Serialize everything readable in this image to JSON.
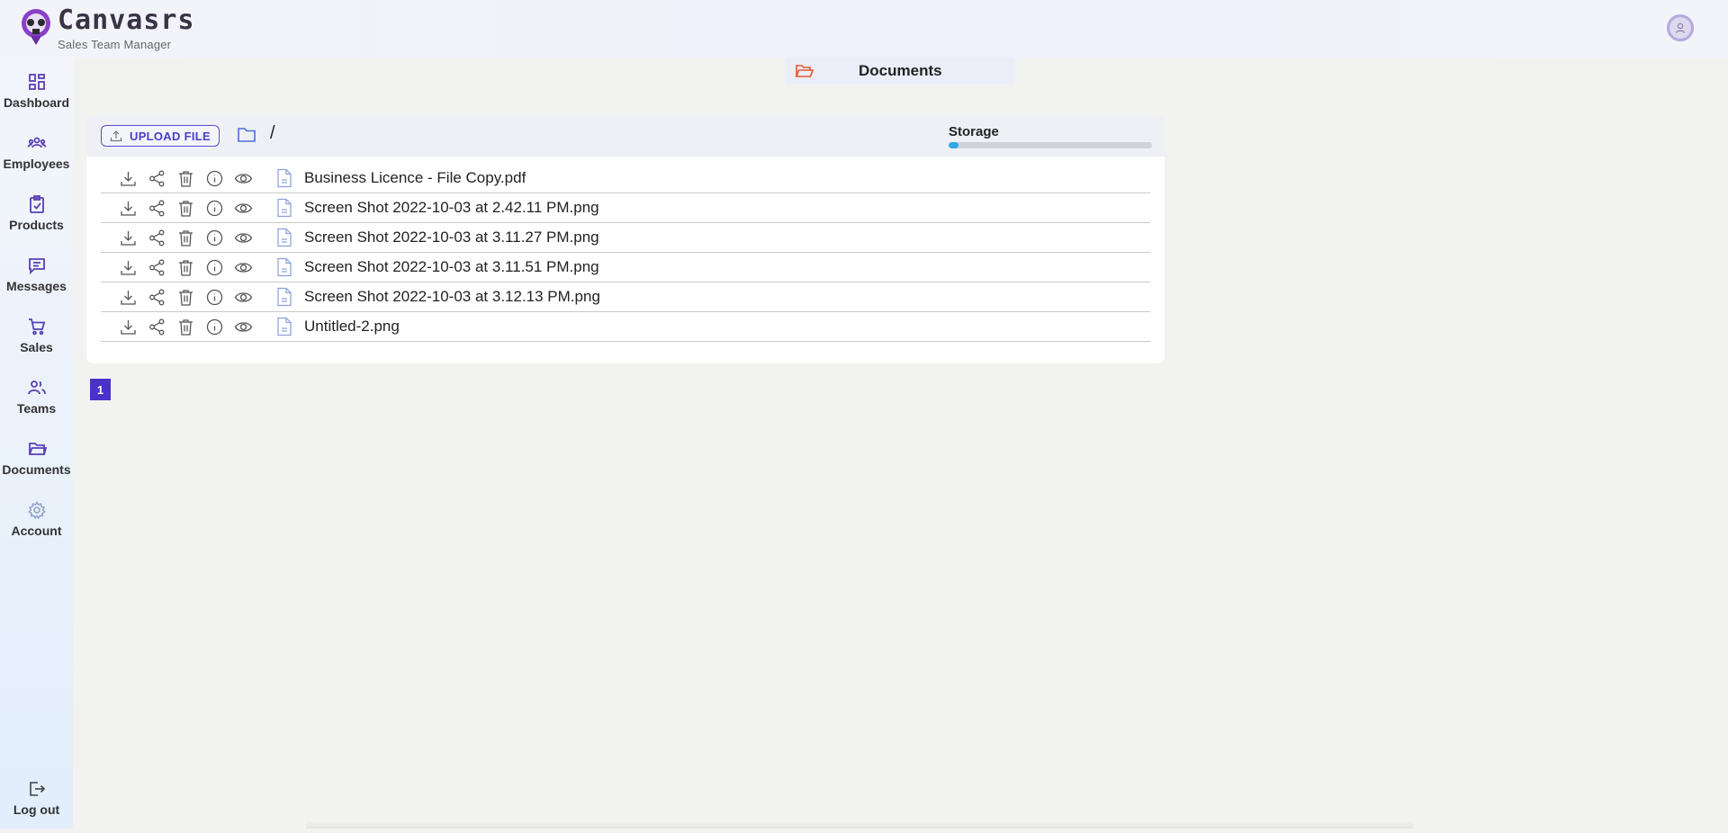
{
  "app": {
    "name": "Canvasrs",
    "subtitle": "Sales Team Manager"
  },
  "sidebar": {
    "items": [
      {
        "label": "Dashboard",
        "icon": "dashboard-icon"
      },
      {
        "label": "Employees",
        "icon": "employees-icon"
      },
      {
        "label": "Products",
        "icon": "products-icon"
      },
      {
        "label": "Messages",
        "icon": "messages-icon"
      },
      {
        "label": "Sales",
        "icon": "cart-icon"
      },
      {
        "label": "Teams",
        "icon": "teams-icon"
      },
      {
        "label": "Documents",
        "icon": "folder-icon"
      },
      {
        "label": "Account",
        "icon": "gear-icon"
      }
    ],
    "logout_label": "Log out"
  },
  "page_tab": {
    "label": "Documents"
  },
  "toolbar": {
    "upload_label": "UPLOAD FILE",
    "path": "/",
    "storage_label": "Storage",
    "storage_used_fraction": 0.05
  },
  "files": [
    {
      "name": "Business Licence - File Copy.pdf"
    },
    {
      "name": "Screen Shot 2022-10-03 at 2.42.11 PM.png"
    },
    {
      "name": "Screen Shot 2022-10-03 at 3.11.27 PM.png"
    },
    {
      "name": "Screen Shot 2022-10-03 at 3.11.51 PM.png"
    },
    {
      "name": "Screen Shot 2022-10-03 at 3.12.13 PM.png"
    },
    {
      "name": "Untitled-2.png"
    }
  ],
  "pagination": {
    "current_page": "1"
  },
  "colors": {
    "accent": "#4a32c8",
    "icon_purple": "#5a3fb5",
    "folder_orange": "#e8572a",
    "storage_fill": "#2fa8e6"
  }
}
